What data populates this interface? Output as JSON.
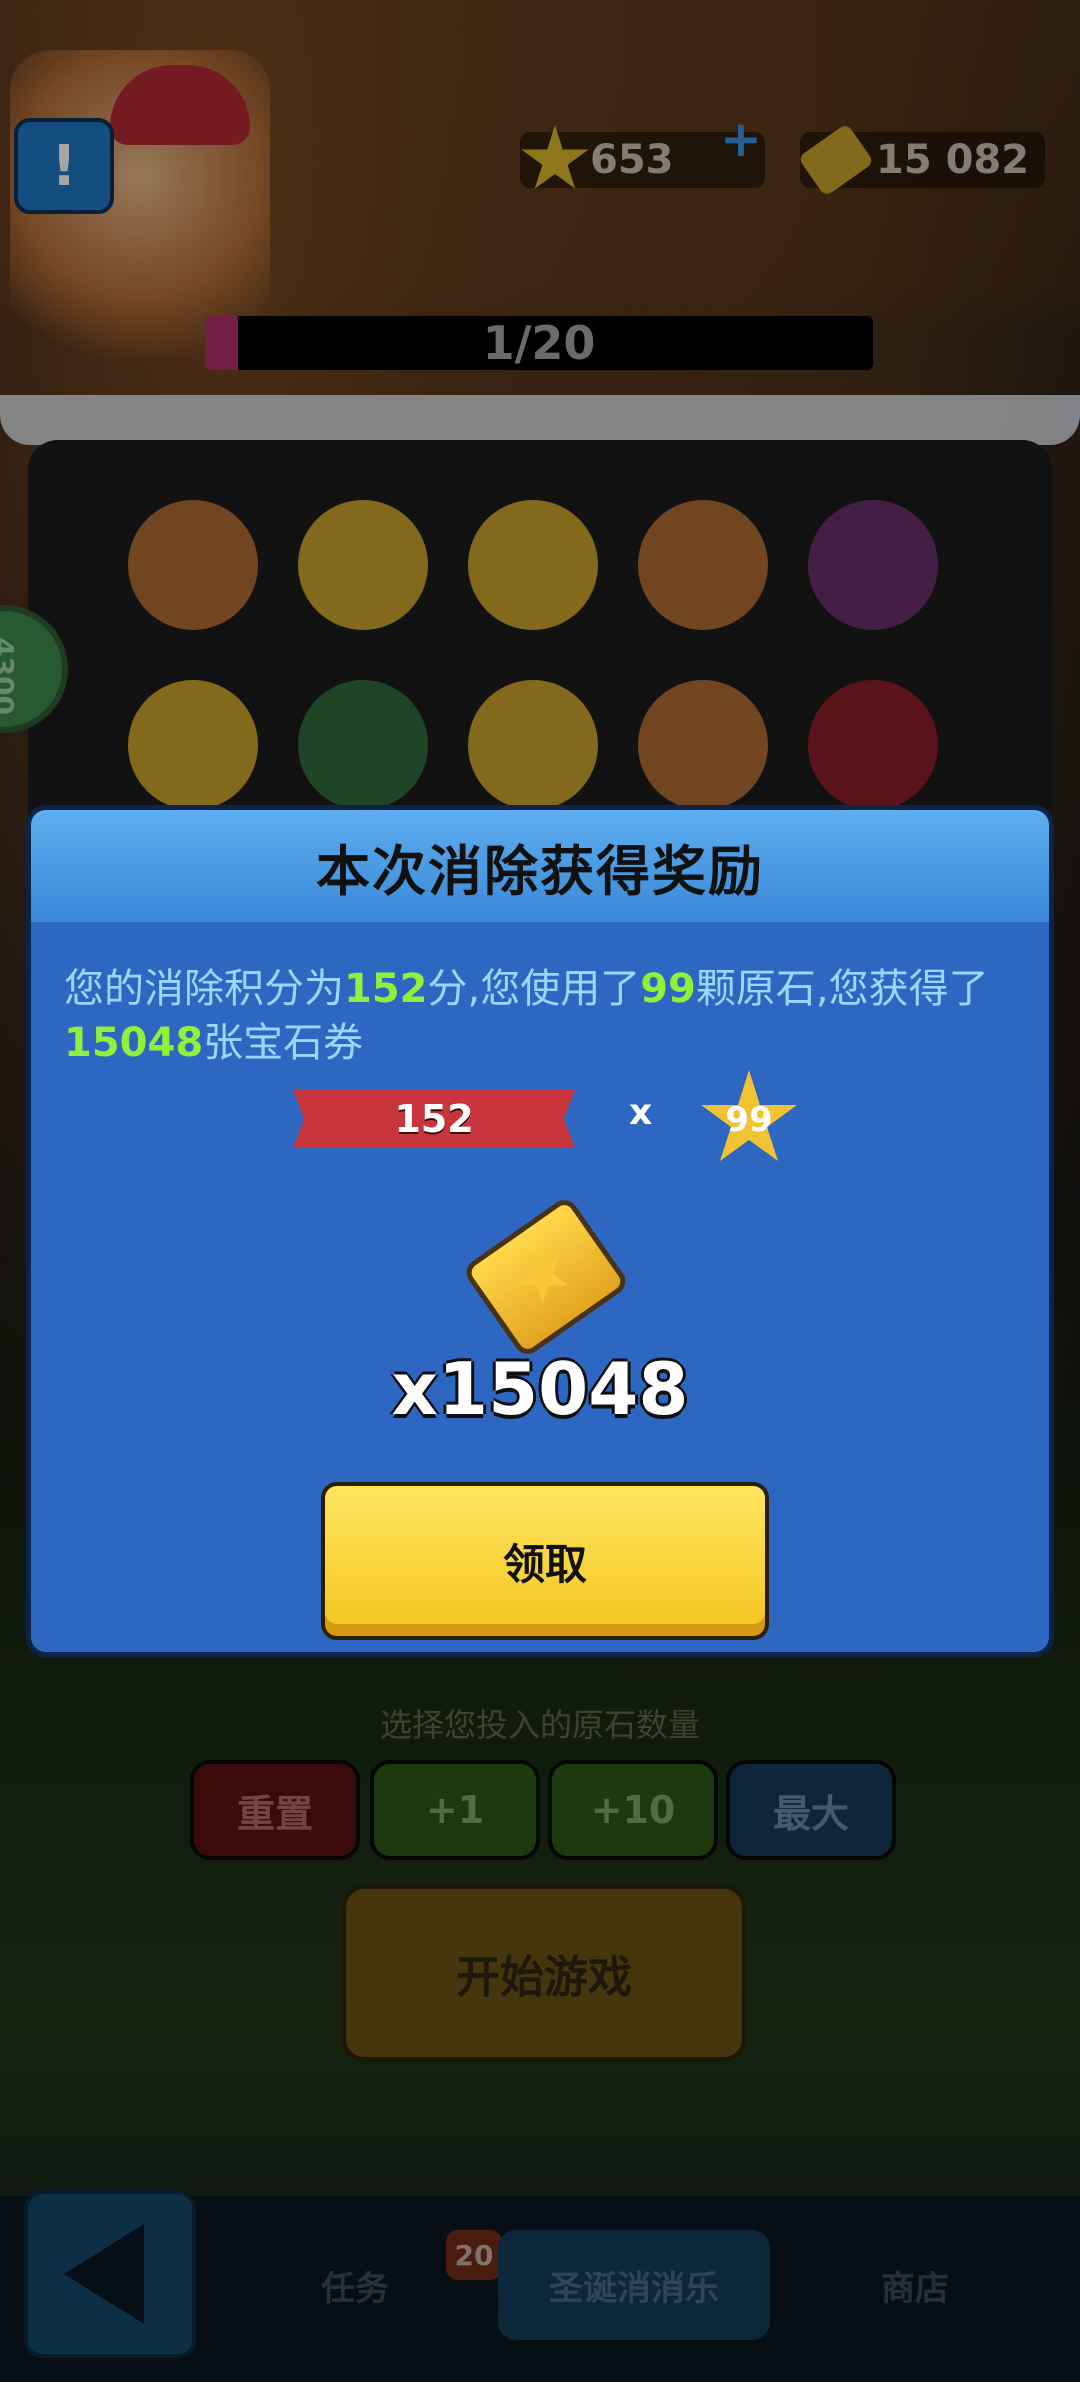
{
  "header": {
    "stars": "653",
    "tickets": "15 082",
    "progress_text": "1/20",
    "progress_fraction": 0.05
  },
  "side_badge": "4300",
  "game_area": {
    "hint": "选择您投入的原石数量",
    "reset_label": "重置",
    "plus1_label": "+1",
    "plus10_label": "+10",
    "max_label": "最大",
    "start_label": "开始游戏"
  },
  "tabs": {
    "task": "任务",
    "task_badge": "20",
    "game": "圣诞消消乐",
    "shop": "商店"
  },
  "modal": {
    "title": "本次消除获得奖励",
    "desc_1": "您的消除积分为",
    "score": "152",
    "desc_2": "分,您使用了",
    "stones": "99",
    "desc_3": "颗原石,您获得了",
    "reward": "15048",
    "desc_4": "张宝石券",
    "ribbon_value": "152",
    "times_sign": "x",
    "star_value": "99",
    "amount_text": "x15048",
    "claim_label": "领取"
  },
  "colors": {
    "modal_bg": "#2e67c2",
    "highlight": "#92f03a",
    "claim_button": "#f2c51e"
  }
}
